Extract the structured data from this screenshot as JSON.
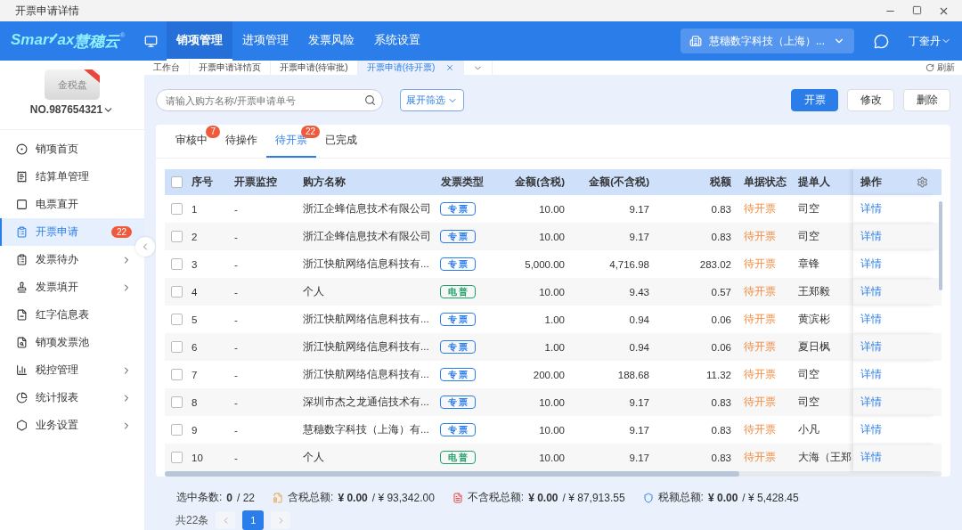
{
  "window": {
    "title": "开票申请详情"
  },
  "header": {
    "logo": {
      "before": "Smar",
      "after": "ax",
      "brand": "慧穗云",
      "mark": "®"
    },
    "nav": [
      {
        "label": "销项管理",
        "selected": true
      },
      {
        "label": "进项管理",
        "selected": false
      },
      {
        "label": "发票风险",
        "selected": false
      },
      {
        "label": "系统设置",
        "selected": false
      }
    ],
    "company": "慧穗数字科技（上海）...",
    "user": "丁奎丹"
  },
  "device": {
    "label": "金税盘",
    "number": "NO.987654321"
  },
  "sidebar": {
    "items": [
      {
        "label": "销项首页",
        "selected": false,
        "has_children": false
      },
      {
        "label": "结算单管理",
        "selected": false,
        "has_children": false
      },
      {
        "label": "电票直开",
        "selected": false,
        "has_children": false
      },
      {
        "label": "开票申请",
        "selected": true,
        "has_children": false,
        "badge": "22"
      },
      {
        "label": "发票待办",
        "selected": false,
        "has_children": true
      },
      {
        "label": "发票填开",
        "selected": false,
        "has_children": true
      },
      {
        "label": "红字信息表",
        "selected": false,
        "has_children": false
      },
      {
        "label": "销项发票池",
        "selected": false,
        "has_children": false
      },
      {
        "label": "税控管理",
        "selected": false,
        "has_children": true
      },
      {
        "label": "统计报表",
        "selected": false,
        "has_children": true
      },
      {
        "label": "业务设置",
        "selected": false,
        "has_children": true
      }
    ]
  },
  "page_tabs": [
    {
      "label": "工作台",
      "selected": false,
      "closable": false
    },
    {
      "label": "开票申请详情页",
      "selected": false,
      "closable": false
    },
    {
      "label": "开票申请(待审批)",
      "selected": false,
      "closable": false
    },
    {
      "label": "开票申请(待开票)",
      "selected": true,
      "closable": true
    }
  ],
  "refresh": "刷新",
  "search": {
    "placeholder": "请输入购方名称/开票申请单号"
  },
  "filter_button": "展开筛选",
  "buttons": [
    {
      "label": "开票",
      "kind": "primary"
    },
    {
      "label": "修改",
      "kind": "default"
    },
    {
      "label": "删除",
      "kind": "default"
    }
  ],
  "status_tabs": [
    {
      "label": "审核中",
      "selected": false,
      "badge": "7"
    },
    {
      "label": "待操作",
      "selected": false
    },
    {
      "label": "待开票",
      "selected": true,
      "badge": "22"
    },
    {
      "label": "已完成",
      "selected": false
    }
  ],
  "table": {
    "all_checked": false,
    "columns": [
      "序号",
      "开票监控",
      "购方名称",
      "发票类型",
      "金额(含税)",
      "金额(不含税)",
      "税额",
      "单据状态",
      "提单人",
      "操作"
    ],
    "rows": [
      {
        "checked": false,
        "no": "1",
        "monitor": "-",
        "buyer": "浙江企蜂信息技术有限公司",
        "type": "专票",
        "color": "#2b7de9",
        "gross": "10.00",
        "net": "9.17",
        "tax": "0.83",
        "status": "待开票",
        "submitter": "司空",
        "action": "详情"
      },
      {
        "checked": false,
        "no": "2",
        "monitor": "-",
        "buyer": "浙江企蜂信息技术有限公司",
        "type": "专票",
        "color": "#2b7de9",
        "gross": "10.00",
        "net": "9.17",
        "tax": "0.83",
        "status": "待开票",
        "submitter": "司空",
        "action": "详情"
      },
      {
        "checked": false,
        "no": "3",
        "monitor": "-",
        "buyer": "浙江快航网络信息科技有...",
        "type": "专票",
        "color": "#2b7de9",
        "gross": "5,000.00",
        "net": "4,716.98",
        "tax": "283.02",
        "status": "待开票",
        "submitter": "章锋",
        "action": "详情"
      },
      {
        "checked": false,
        "no": "4",
        "monitor": "-",
        "buyer": "个人",
        "type": "电普",
        "color": "#22a06b",
        "gross": "10.00",
        "net": "9.43",
        "tax": "0.57",
        "status": "待开票",
        "submitter": "王郑毅",
        "action": "详情"
      },
      {
        "checked": false,
        "no": "5",
        "monitor": "-",
        "buyer": "浙江快航网络信息科技有...",
        "type": "专票",
        "color": "#2b7de9",
        "gross": "1.00",
        "net": "0.94",
        "tax": "0.06",
        "status": "待开票",
        "submitter": "黄滨彬",
        "action": "详情"
      },
      {
        "checked": false,
        "no": "6",
        "monitor": "-",
        "buyer": "浙江快航网络信息科技有...",
        "type": "专票",
        "color": "#2b7de9",
        "gross": "1.00",
        "net": "0.94",
        "tax": "0.06",
        "status": "待开票",
        "submitter": "夏日枫",
        "action": "详情"
      },
      {
        "checked": false,
        "no": "7",
        "monitor": "-",
        "buyer": "浙江快航网络信息科技有...",
        "type": "专票",
        "color": "#2b7de9",
        "gross": "200.00",
        "net": "188.68",
        "tax": "11.32",
        "status": "待开票",
        "submitter": "司空",
        "action": "详情"
      },
      {
        "checked": false,
        "no": "8",
        "monitor": "-",
        "buyer": "深圳市杰之龙通信技术有...",
        "type": "专票",
        "color": "#2b7de9",
        "gross": "10.00",
        "net": "9.17",
        "tax": "0.83",
        "status": "待开票",
        "submitter": "司空",
        "action": "详情"
      },
      {
        "checked": false,
        "no": "9",
        "monitor": "-",
        "buyer": "慧穗数字科技（上海）有...",
        "type": "专票",
        "color": "#2b7de9",
        "gross": "10.00",
        "net": "9.17",
        "tax": "0.83",
        "status": "待开票",
        "submitter": "小凡",
        "action": "详情"
      },
      {
        "checked": false,
        "no": "10",
        "monitor": "-",
        "buyer": "个人",
        "type": "电普",
        "color": "#22a06b",
        "gross": "10.00",
        "net": "9.17",
        "tax": "0.83",
        "status": "待开票",
        "submitter": "大海（王郑",
        "action": "详情"
      }
    ]
  },
  "summary": [
    {
      "label": "选中条数:",
      "value": "0",
      "total": "/ 22",
      "kind": "count"
    },
    {
      "label": "含税总额:",
      "value": "¥ 0.00",
      "total": "/ ¥ 93,342.00",
      "kind": "gross"
    },
    {
      "label": "不含税总额:",
      "value": "¥ 0.00",
      "total": "/ ¥ 87,913.55",
      "kind": "net"
    },
    {
      "label": "税额总额:",
      "value": "¥ 0.00",
      "total": "/ ¥ 5,428.45",
      "kind": "tax"
    }
  ],
  "pagination": {
    "total": "共22条",
    "pages": [
      {
        "label": "1",
        "selected": true
      }
    ]
  }
}
